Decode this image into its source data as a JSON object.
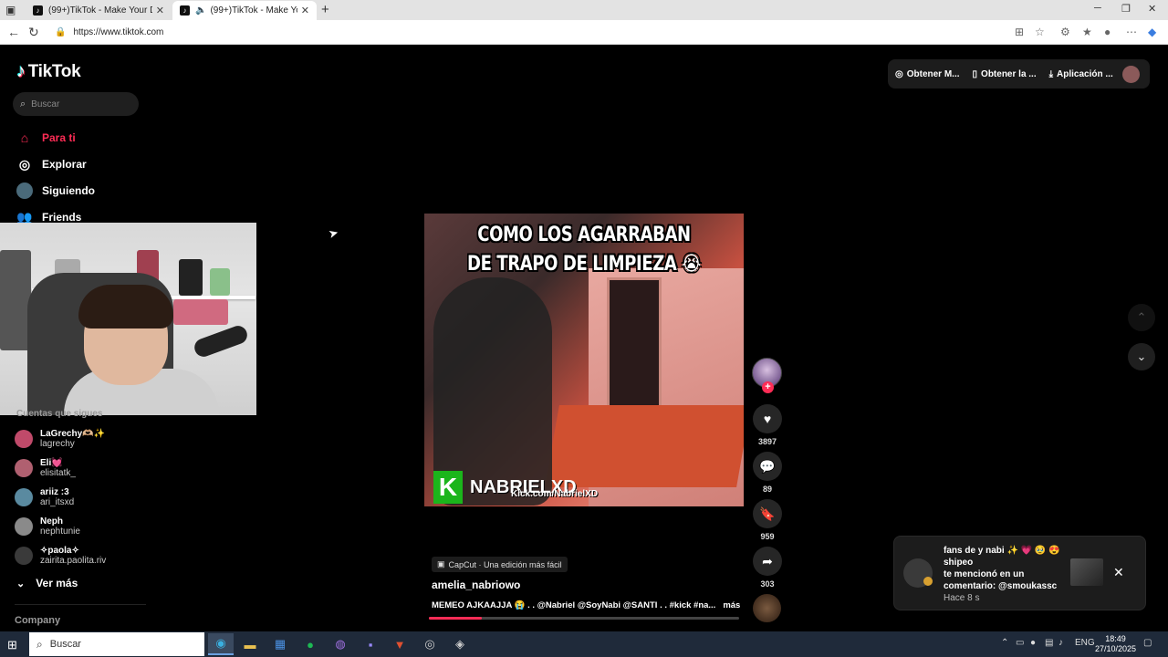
{
  "browser": {
    "tabs": [
      {
        "title": "(99+)TikTok - Make Your Day"
      },
      {
        "title": "(99+)TikTok - Make Your Day"
      }
    ],
    "url": "https://www.tiktok.com"
  },
  "sidebar": {
    "logo": "TikTok",
    "search_placeholder": "Buscar",
    "nav": [
      {
        "label": "Para ti",
        "icon": "home-icon",
        "active": true
      },
      {
        "label": "Explorar",
        "icon": "compass-icon"
      },
      {
        "label": "Siguiendo",
        "icon": "following-avatar-icon"
      },
      {
        "label": "Friends",
        "icon": "friends-icon"
      }
    ],
    "following_title": "Cuentas que sigues",
    "following": [
      {
        "name": "LaGrechy🫶🏼✨",
        "user": "lagrechy"
      },
      {
        "name": "Eli💓",
        "user": "elisitatk_"
      },
      {
        "name": "ariiz :3",
        "user": "ari_itsxd"
      },
      {
        "name": "Neph",
        "user": "nephtunie"
      },
      {
        "name": "✧paola✧",
        "user": "zairita.paolita.riv"
      }
    ],
    "see_more": "Ver más",
    "company": "Company"
  },
  "topbar": {
    "items": [
      {
        "label": "Obtener M...",
        "icon": "coin-icon"
      },
      {
        "label": "Obtener la ...",
        "icon": "phone-icon"
      },
      {
        "label": "Aplicación ...",
        "icon": "download-icon"
      }
    ]
  },
  "video": {
    "caption_line1": "COMO LOS AGARRABAN",
    "caption_line2": "DE TRAPO DE LIMPIEZA 😭",
    "watermark": "NABRIELXD",
    "watermark_sub": "Kick.com/NabrielXD",
    "capcut": "CapCut · Una edición más fácil",
    "author": "amelia_nabriowo",
    "description": "MEMEO AJKAAJJA 😭 . . @Nabriel @SoyNabi @SANTI . . #kick #na...",
    "more": "más",
    "progress": 0.17,
    "likes": "3897",
    "comments": "89",
    "saves": "959",
    "shares": "303"
  },
  "notification": {
    "line1": "fans de y nabi ✨ 💗 🥹 😍",
    "line2": "shipeo",
    "line3": "te mencionó en un",
    "line4": "comentario: @smoukassc",
    "time": "Hace 8 s"
  },
  "taskbar": {
    "search": "Buscar",
    "lang": "ENG",
    "time": "18:49",
    "date": "27/10/2025"
  }
}
